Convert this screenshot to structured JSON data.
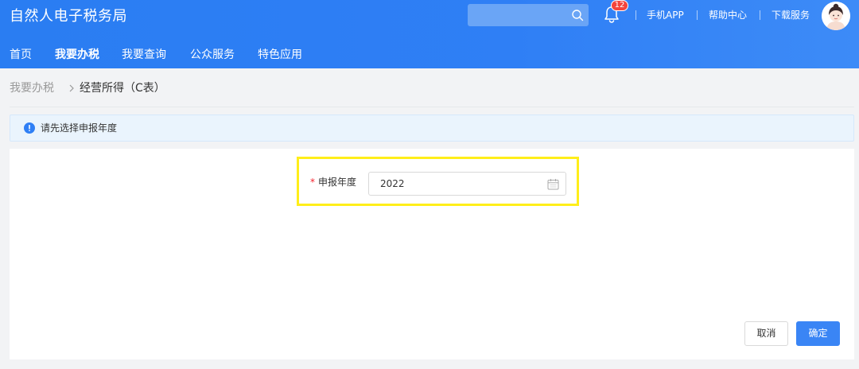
{
  "header": {
    "app_title": "自然人电子税务局",
    "search": {
      "value": "",
      "placeholder": ""
    },
    "notifications": {
      "count": "12"
    },
    "links": [
      "手机APP",
      "帮助中心",
      "下载服务"
    ]
  },
  "nav": {
    "items": [
      {
        "label": "首页",
        "active": false
      },
      {
        "label": "我要办税",
        "active": true
      },
      {
        "label": "我要查询",
        "active": false
      },
      {
        "label": "公众服务",
        "active": false
      },
      {
        "label": "特色应用",
        "active": false
      }
    ]
  },
  "breadcrumb": {
    "items": [
      "我要办税",
      "经营所得（C表）"
    ]
  },
  "notice": {
    "text": "请先选择申报年度"
  },
  "form": {
    "year_field": {
      "required_mark": "*",
      "label": "申报年度",
      "value": "2022"
    }
  },
  "actions": {
    "cancel_label": "取消",
    "confirm_label": "确定"
  },
  "colors": {
    "header_blue": "#2f7ff5",
    "primary_button": "#3a85f5",
    "highlight_yellow": "#ffee1a",
    "badge_red": "#f4443c",
    "notice_bg": "#eaf4fd"
  },
  "icons": [
    "search-icon",
    "bell-icon",
    "avatar",
    "chevron-right-icon",
    "info-icon",
    "calendar-icon"
  ]
}
